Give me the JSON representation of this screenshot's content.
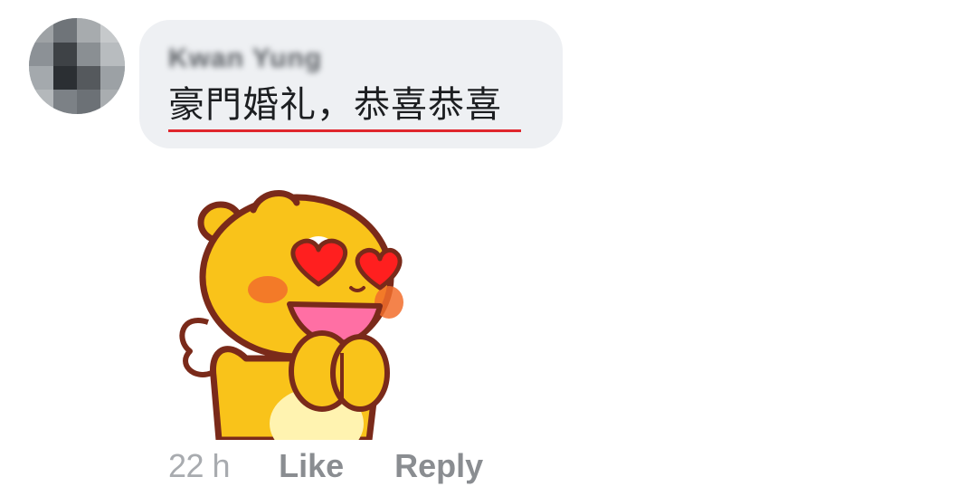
{
  "comment": {
    "author_name": "Kwan Yung",
    "text": "豪門婚礼，恭喜恭喜",
    "sticker_icon": "heart-eyes-chick-sticker",
    "timestamp": "22 h",
    "like_label": "Like",
    "reply_label": "Reply"
  },
  "colors": {
    "bubble_background": "#eef0f3",
    "action_text": "#8a8d91",
    "spellcheck_underline": "#e0262d"
  }
}
